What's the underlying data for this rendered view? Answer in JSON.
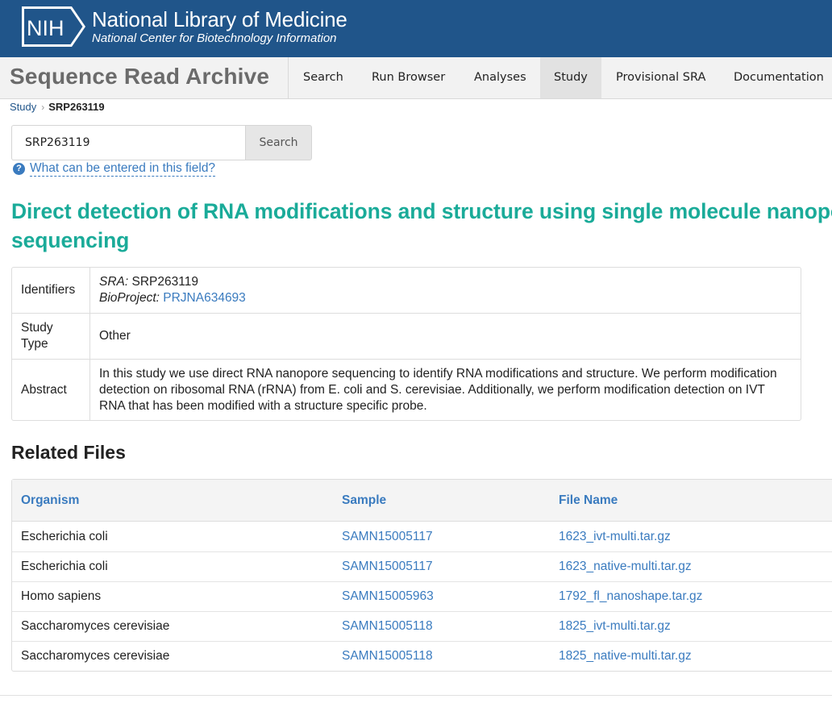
{
  "header": {
    "logo_text": "NIH",
    "title": "National Library of Medicine",
    "subtitle": "National Center for Biotechnology Information",
    "colors": {
      "background": "#20558a",
      "text": "#ffffff"
    }
  },
  "sra_bar": {
    "title": "Sequence Read Archive",
    "nav": [
      {
        "label": "Search",
        "active": false
      },
      {
        "label": "Run Browser",
        "active": false
      },
      {
        "label": "Analyses",
        "active": false
      },
      {
        "label": "Study",
        "active": true
      },
      {
        "label": "Provisional SRA",
        "active": false
      },
      {
        "label": "Documentation",
        "active": false
      }
    ]
  },
  "breadcrumb": {
    "parent": "Study",
    "current": "SRP263119"
  },
  "search": {
    "value": "SRP263119",
    "button_label": "Search",
    "help_text": "What can be entered in this field?",
    "help_icon": "question-circle-icon"
  },
  "study": {
    "title": "Direct detection of RNA modifications and structure using single molecule nanopore sequencing",
    "title_color": "#1aab99",
    "identifiers_label": "Identifiers",
    "sra_label": "SRA:",
    "sra_value": "SRP263119",
    "bioproject_label": "BioProject:",
    "bioproject_value": "PRJNA634693",
    "type_label": "Study Type",
    "type_value": "Other",
    "abstract_label": "Abstract",
    "abstract_value": "In this study we use direct RNA nanopore sequencing to identify RNA modifications and structure. We perform modification detection on ribosomal RNA (rRNA) from E. coli and S. cerevisiae. Additionally, we perform modification detection on IVT RNA that has been modified with a structure specific probe."
  },
  "related_files": {
    "heading": "Related Files",
    "columns": [
      "Organism",
      "Sample",
      "File Name"
    ],
    "rows": [
      {
        "organism": "Escherichia coli",
        "sample": "SAMN15005117",
        "file": "1623_ivt-multi.tar.gz"
      },
      {
        "organism": "Escherichia coli",
        "sample": "SAMN15005117",
        "file": "1623_native-multi.tar.gz"
      },
      {
        "organism": "Homo sapiens",
        "sample": "SAMN15005963",
        "file": "1792_fl_nanoshape.tar.gz"
      },
      {
        "organism": "Saccharomyces cerevisiae",
        "sample": "SAMN15005118",
        "file": "1825_ivt-multi.tar.gz"
      },
      {
        "organism": "Saccharomyces cerevisiae",
        "sample": "SAMN15005118",
        "file": "1825_native-multi.tar.gz"
      }
    ]
  },
  "colors": {
    "link": "#3a7bbf",
    "nav_bar": "#f2f2f2",
    "nav_active": "#e2e2e2"
  }
}
